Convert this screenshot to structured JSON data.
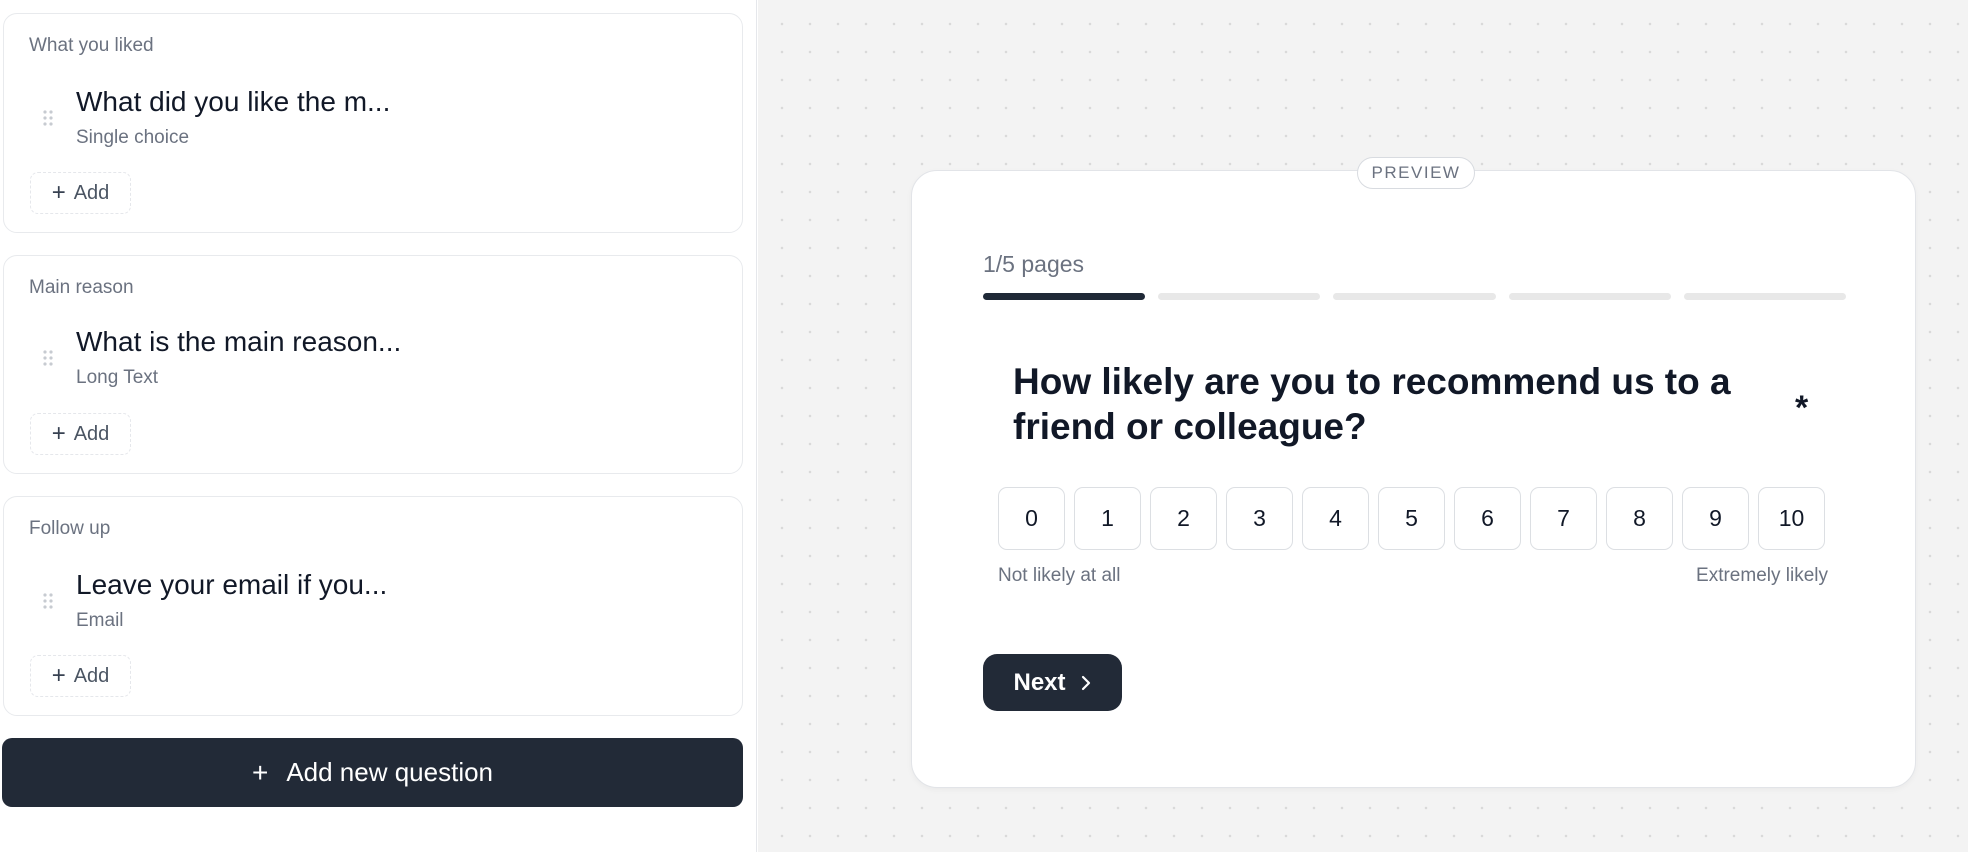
{
  "editor": {
    "sections": [
      {
        "title": "What you liked",
        "question": "What did you like the m...",
        "type": "Single choice",
        "add_label": "Add"
      },
      {
        "title": "Main reason",
        "question": "What is the main reason...",
        "type": "Long Text",
        "add_label": "Add"
      },
      {
        "title": "Follow up",
        "question": "Leave your email if you...",
        "type": "Email",
        "add_label": "Add"
      }
    ],
    "add_question_label": "Add new question",
    "plus_symbol": "+"
  },
  "preview": {
    "badge": "PREVIEW",
    "pages_label": "1/5 pages",
    "progress": {
      "current_page": 1,
      "total_pages": 5
    },
    "question": "How likely are you to recommend us to a friend or colleague?",
    "required_marker": "*",
    "scale": [
      "0",
      "1",
      "2",
      "3",
      "4",
      "5",
      "6",
      "7",
      "8",
      "9",
      "10"
    ],
    "low_label": "Not likely at all",
    "high_label": "Extremely likely",
    "next_label": "Next"
  },
  "colors": {
    "primary_dark": "#222a37",
    "progress_active": "#1f2937",
    "progress_inactive": "#e8e8e8",
    "muted_text": "#6b7280",
    "canvas_bg": "#f3f3f3"
  },
  "icons": {
    "drag_handle": "grip-vertical-icon",
    "add": "plus-icon",
    "next": "chevron-right-icon"
  }
}
